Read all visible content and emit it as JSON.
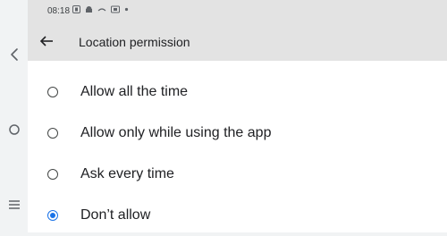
{
  "status_bar": {
    "time": "08:18",
    "icons": [
      "notification-icon",
      "android-icon",
      "cast-icon",
      "screen-record-icon",
      "dot-icon"
    ]
  },
  "app_bar": {
    "title": "Location permission",
    "back_icon": "back-arrow-icon"
  },
  "options": [
    {
      "label": "Allow all the time",
      "selected": false
    },
    {
      "label": "Allow only while using the app",
      "selected": false
    },
    {
      "label": "Ask every time",
      "selected": false
    },
    {
      "label": "Don’t allow",
      "selected": true
    }
  ],
  "nav_rail": {
    "icons": [
      "back-chevron-icon",
      "home-circle-icon",
      "recents-menu-icon"
    ]
  },
  "colors": {
    "accent": "#1a73e8",
    "appbar_bg": "#e3e3e3",
    "content_bg": "#ffffff"
  }
}
